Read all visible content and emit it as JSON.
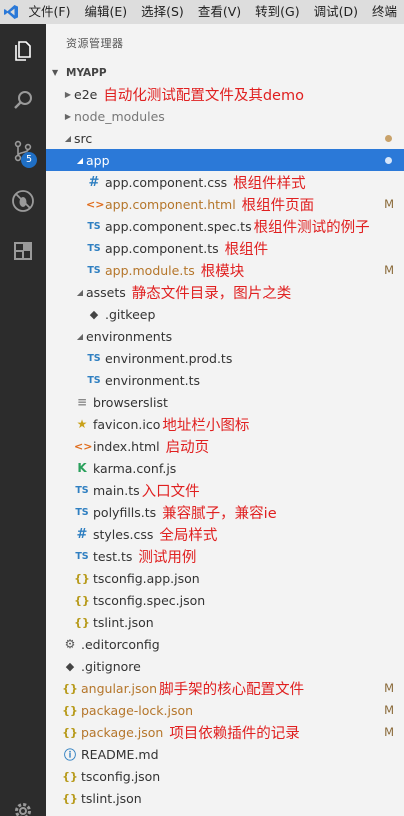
{
  "menubar": {
    "items": [
      "文件(F)",
      "编辑(E)",
      "选择(S)",
      "查看(V)",
      "转到(G)",
      "调试(D)",
      "终端"
    ]
  },
  "activity": {
    "scm_badge": "5"
  },
  "explorer": {
    "title": "资源管理器",
    "section": "MYAPP",
    "tree": [
      {
        "label": "e2e",
        "note": "自动化测试配置文件及其demo"
      },
      {
        "label": "node_modules"
      },
      {
        "label": "src"
      },
      {
        "label": "app"
      },
      {
        "label": "app.component.css",
        "note": "根组件样式"
      },
      {
        "label": "app.component.html",
        "note": "根组件页面",
        "git": "M"
      },
      {
        "label": "app.component.spec.ts",
        "note": "根组件测试的例子"
      },
      {
        "label": "app.component.ts",
        "note": "根组件"
      },
      {
        "label": "app.module.ts",
        "note": "根模块",
        "git": "M"
      },
      {
        "label": "assets",
        "note": "静态文件目录，图片之类"
      },
      {
        "label": ".gitkeep"
      },
      {
        "label": "environments"
      },
      {
        "label": "environment.prod.ts"
      },
      {
        "label": "environment.ts"
      },
      {
        "label": "browserslist"
      },
      {
        "label": "favicon.ico",
        "note": "地址栏小图标"
      },
      {
        "label": "index.html",
        "note": "启动页"
      },
      {
        "label": "karma.conf.js"
      },
      {
        "label": "main.ts",
        "note": "入口文件"
      },
      {
        "label": "polyfills.ts",
        "note": "兼容腻子，兼容ie"
      },
      {
        "label": "styles.css",
        "note": "全局样式"
      },
      {
        "label": "test.ts",
        "note": "测试用例"
      },
      {
        "label": "tsconfig.app.json"
      },
      {
        "label": "tsconfig.spec.json"
      },
      {
        "label": "tslint.json"
      },
      {
        "label": ".editorconfig"
      },
      {
        "label": ".gitignore"
      },
      {
        "label": "angular.json",
        "note": "脚手架的核心配置文件",
        "git": "M"
      },
      {
        "label": "package-lock.json",
        "git": "M"
      },
      {
        "label": "package.json",
        "note": "项目依赖插件的记录",
        "git": "M"
      },
      {
        "label": "README.md"
      },
      {
        "label": "tsconfig.json"
      },
      {
        "label": "tslint.json"
      }
    ]
  }
}
